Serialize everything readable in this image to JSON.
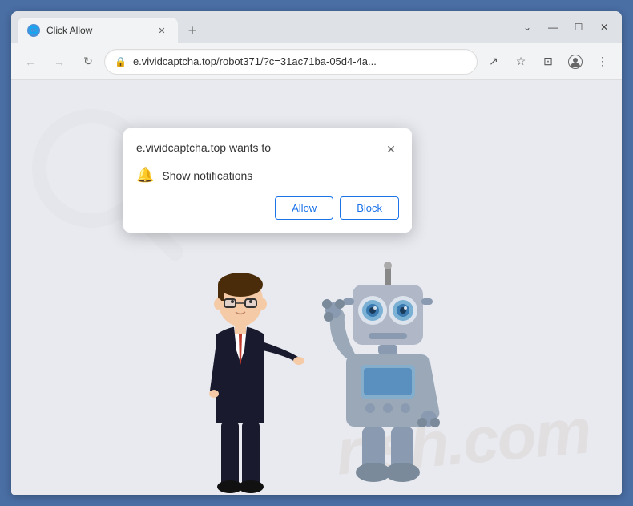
{
  "browser": {
    "tab": {
      "title": "Click Allow",
      "favicon": "🌐"
    },
    "window_controls": {
      "minimize": "—",
      "maximize": "☐",
      "close": "✕",
      "profile": "⌄"
    },
    "nav": {
      "back": "←",
      "forward": "→",
      "refresh": "↻"
    },
    "address_bar": {
      "url": "e.vividcaptcha.top/robot371/?c=31ac71ba-05d4-4a...",
      "lock": "🔒"
    },
    "toolbar_icons": {
      "share": "↗",
      "bookmark": "☆",
      "split": "⊡",
      "profile": "👤",
      "menu": "⋮"
    }
  },
  "popup": {
    "title": "e.vividcaptcha.top wants to",
    "notification_text": "Show notifications",
    "close_label": "✕",
    "allow_label": "Allow",
    "block_label": "Block"
  },
  "page": {
    "watermark": "rish.com"
  }
}
